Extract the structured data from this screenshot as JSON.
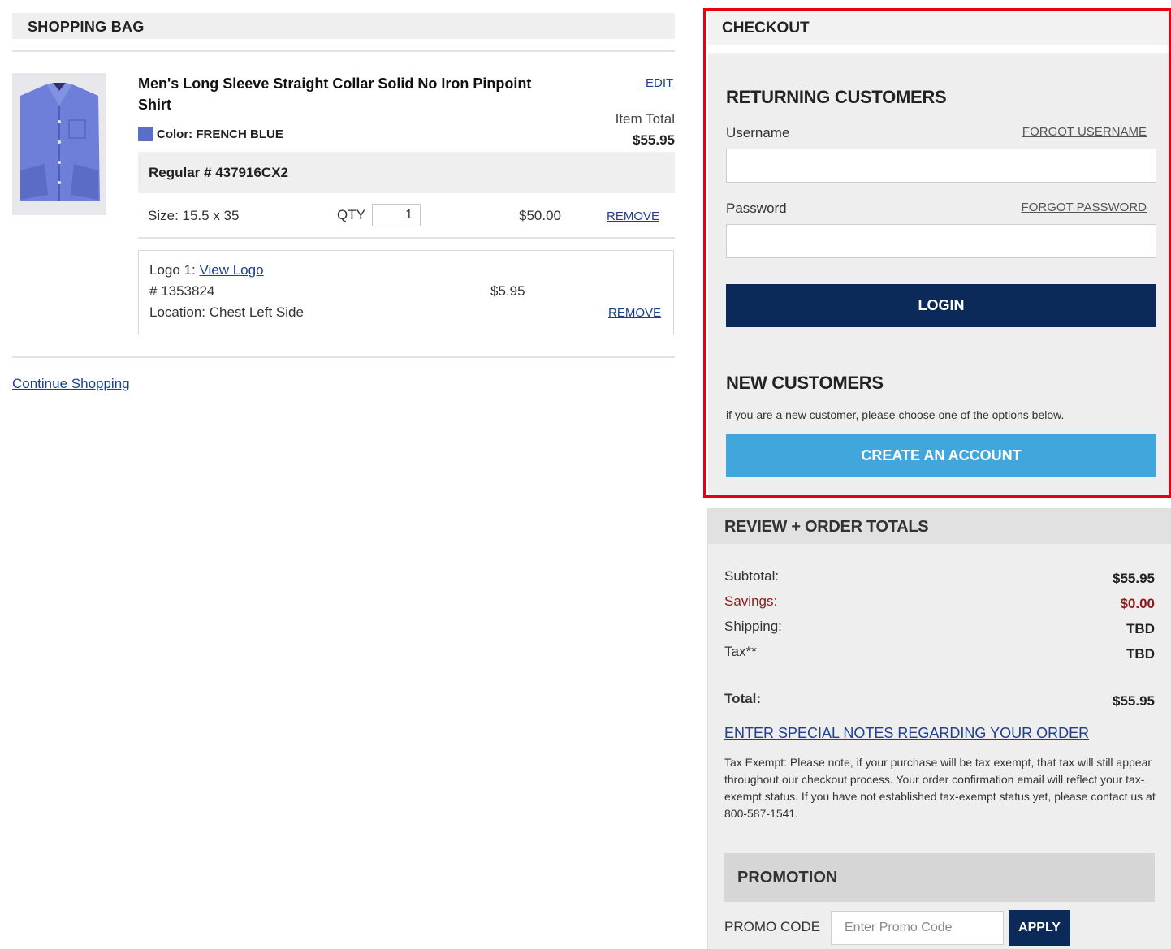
{
  "bag": {
    "title": "SHOPPING BAG",
    "item": {
      "name": "Men's Long Sleeve Straight Collar Solid No Iron Pinpoint Shirt",
      "edit": "EDIT",
      "color": "Color: FRENCH BLUE",
      "swatch_color": "#5b6fc4",
      "item_total_label": "Item Total",
      "item_total": "$55.95",
      "regular": "Regular # 437916CX2",
      "size": "Size: 15.5 x 35",
      "qty_label": "QTY",
      "qty": "1",
      "price": "$50.00",
      "remove": "REMOVE"
    },
    "logo": {
      "label": "Logo 1: ",
      "view_link": "View Logo",
      "number": "# 1353824",
      "location": "Location: Chest Left Side",
      "price": "$5.95",
      "remove": "REMOVE"
    },
    "continue": "Continue Shopping"
  },
  "checkout": {
    "title": "CHECKOUT",
    "returning_title": "RETURNING CUSTOMERS",
    "username_label": "Username",
    "forgot_username": "FORGOT USERNAME",
    "password_label": "Password",
    "forgot_password": "FORGOT PASSWORD",
    "login": "LOGIN",
    "new_title": "NEW CUSTOMERS",
    "new_desc": "if you are a new customer, please choose one of the options below.",
    "create": "CREATE AN ACCOUNT"
  },
  "review": {
    "title": "REVIEW + ORDER TOTALS",
    "subtotal_label": "Subtotal:",
    "subtotal": "$55.95",
    "savings_label": "Savings:",
    "savings": "$0.00",
    "shipping_label": "Shipping:",
    "shipping": "TBD",
    "tax_label": "Tax**",
    "tax": "TBD",
    "total_label": "Total:",
    "total": "$55.95",
    "notes_link": "ENTER SPECIAL NOTES REGARDING YOUR ORDER",
    "tax_note": "Tax Exempt: Please note, if your purchase will be tax exempt, that tax will still appear throughout our checkout process. Your order confirmation email will reflect your tax-exempt status. If you have not established tax-exempt status yet, please contact us at 800-587-1541.",
    "promo_title": "PROMOTION",
    "promo_label": "PROMO CODE",
    "promo_placeholder": "Enter Promo Code",
    "apply": "APPLY"
  },
  "colors": {
    "login_bg": "#0b2a59",
    "create_bg": "#41a6dc",
    "savings": "#8b1a1a",
    "highlight_border": "#e60012",
    "link": "#1d3f8f"
  }
}
